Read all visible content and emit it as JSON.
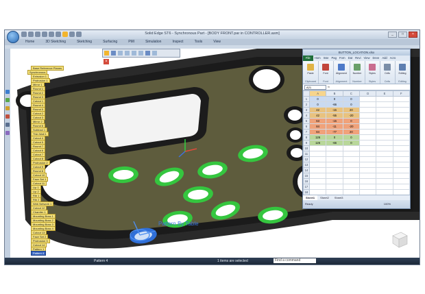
{
  "window": {
    "title": "Solid Edge ST6 - Synchronous Part - [BODY FRONT.par in CONTROLLER.asm]"
  },
  "ribbon": {
    "tabs": [
      "Home",
      "3D Sketching",
      "Sketching",
      "Surfacing",
      "PMI",
      "Simulation",
      "Inspect",
      "Tools",
      "View"
    ]
  },
  "pathfinder": {
    "items": [
      {
        "label": "Base Reference Planes",
        "indent": 2
      },
      {
        "label": "Synchronous",
        "indent": 1
      },
      {
        "label": "Extrusion 1",
        "indent": 2
      },
      {
        "label": "Protrusion 1",
        "indent": 2
      },
      {
        "label": "Mirror 1",
        "indent": 2
      },
      {
        "label": "Round 1",
        "indent": 2
      },
      {
        "label": "Round 2",
        "indent": 2
      },
      {
        "label": "Round 3",
        "indent": 2
      },
      {
        "label": "Cutout 1",
        "indent": 2
      },
      {
        "label": "Round 4",
        "indent": 2
      },
      {
        "label": "Round 5",
        "indent": 2
      },
      {
        "label": "Cutout 2",
        "indent": 2
      },
      {
        "label": "Cutout 3",
        "indent": 2
      },
      {
        "label": "Mirror 2",
        "indent": 2
      },
      {
        "label": "Round 6",
        "indent": 2
      },
      {
        "label": "Subtract 1",
        "indent": 2
      },
      {
        "label": "Thin Wall 1",
        "indent": 2
      },
      {
        "label": "Cutout 4",
        "indent": 2
      },
      {
        "label": "Cutout 5",
        "indent": 2
      },
      {
        "label": "Round 7",
        "indent": 2
      },
      {
        "label": "Cutout 6",
        "indent": 2
      },
      {
        "label": "Cutout 7",
        "indent": 2
      },
      {
        "label": "Cutout 8",
        "indent": 2
      },
      {
        "label": "Protrusion 2",
        "indent": 2
      },
      {
        "label": "Cutout 9",
        "indent": 2
      },
      {
        "label": "Round 8",
        "indent": 2
      },
      {
        "label": "Cutout 10",
        "indent": 2
      },
      {
        "label": "Face Set 1",
        "indent": 2
      },
      {
        "label": "Cutout 11",
        "indent": 2
      },
      {
        "label": "Lip 1",
        "indent": 2
      },
      {
        "label": "Lip 2",
        "indent": 2
      },
      {
        "label": "Rib 1",
        "indent": 2
      },
      {
        "label": "Rib 2",
        "indent": 2
      },
      {
        "label": "Web Network 1",
        "indent": 2
      },
      {
        "label": "Cutout 12",
        "indent": 2
      },
      {
        "label": "Chamfer 1",
        "indent": 2
      },
      {
        "label": "Mounting Boss 1",
        "indent": 2
      },
      {
        "label": "Mounting Boss 2",
        "indent": 2
      },
      {
        "label": "Mounting Boss 3",
        "indent": 2
      },
      {
        "label": "Mounting Boss 4",
        "indent": 2
      },
      {
        "label": "Cutout 13",
        "indent": 2
      },
      {
        "label": "Face Set 2",
        "indent": 2
      },
      {
        "label": "Protrusion 3",
        "indent": 2
      },
      {
        "label": "Cutout 14",
        "indent": 2
      },
      {
        "label": "Pattern 1",
        "indent": 2
      },
      {
        "label": "Pattern 4",
        "indent": 2,
        "selected": true
      }
    ]
  },
  "viewport": {
    "feature_label": "Pattern By Table"
  },
  "spreadsheet": {
    "title": "BUTTON_LOCATION.xlsx",
    "tabs": [
      "File",
      "Hom",
      "Inse",
      "Pag",
      "Forn",
      "Dat",
      "Revi",
      "View",
      "Deve",
      "Add",
      "Acro"
    ],
    "groups": [
      {
        "group": "Clipboard",
        "name": "Paste"
      },
      {
        "group": "Font",
        "name": "Font"
      },
      {
        "group": "Alignment",
        "name": "Alignment"
      },
      {
        "group": "Number",
        "name": "Number"
      },
      {
        "group": "Styles",
        "name": "Styles"
      },
      {
        "group": "Cells",
        "name": "Cells"
      },
      {
        "group": "Editing",
        "name": "Editing"
      }
    ],
    "name_box": "A21",
    "fx": "fx",
    "columns": [
      "A",
      "B",
      "C",
      "D",
      "E",
      "F"
    ],
    "rows": [
      {
        "n": "1",
        "cells": [
          "0",
          "0",
          "0"
        ],
        "color": "#c9daf1"
      },
      {
        "n": "2",
        "cells": [
          "0",
          "-66",
          "0"
        ],
        "color": "#c9daf1"
      },
      {
        "n": "3",
        "cells": [
          "42",
          "-15",
          "20"
        ],
        "color": "#e9c27e"
      },
      {
        "n": "4",
        "cells": [
          "42",
          "-55",
          "-20"
        ],
        "color": "#e9c27e"
      },
      {
        "n": "5",
        "cells": [
          "63",
          "-15",
          "0"
        ],
        "color": "#f0a27a"
      },
      {
        "n": "6",
        "cells": [
          "84",
          "-11",
          "-20"
        ],
        "color": "#f0a27a"
      },
      {
        "n": "7",
        "cells": [
          "84",
          "-77",
          "20"
        ],
        "color": "#f0a27a"
      },
      {
        "n": "8",
        "cells": [
          "126",
          "0",
          "0"
        ],
        "color": "#b9d79a"
      },
      {
        "n": "9",
        "cells": [
          "126",
          "-66",
          "0"
        ],
        "color": "#b9d79a"
      },
      {
        "n": "10",
        "cells": [
          "",
          "",
          ""
        ]
      },
      {
        "n": "11",
        "cells": [
          "",
          "",
          ""
        ]
      },
      {
        "n": "12",
        "cells": [
          "",
          "",
          ""
        ]
      },
      {
        "n": "13",
        "cells": [
          "",
          "",
          ""
        ]
      },
      {
        "n": "14",
        "cells": [
          "",
          "",
          ""
        ]
      },
      {
        "n": "15",
        "cells": [
          "",
          "",
          ""
        ]
      },
      {
        "n": "16",
        "cells": [
          "",
          "",
          ""
        ]
      },
      {
        "n": "17",
        "cells": [
          "",
          "",
          ""
        ]
      },
      {
        "n": "18",
        "cells": [
          "",
          "",
          ""
        ]
      },
      {
        "n": "19",
        "cells": [
          "",
          "",
          ""
        ]
      },
      {
        "n": "20",
        "cells": [
          "",
          "",
          ""
        ]
      }
    ],
    "sheets": [
      "Sheet1",
      "Sheet2",
      "Sheet3"
    ],
    "status": "Ready",
    "zoom": "100%"
  },
  "statusbar": {
    "feature": "Pattern 4",
    "selection": "1 items are selected",
    "command_prompt": "Find a command"
  },
  "colors": {
    "part_surface": "#5b5a3c",
    "part_body": "#2b2b2b",
    "highlight": "#35c63f",
    "selection": "#2f6fd8"
  }
}
